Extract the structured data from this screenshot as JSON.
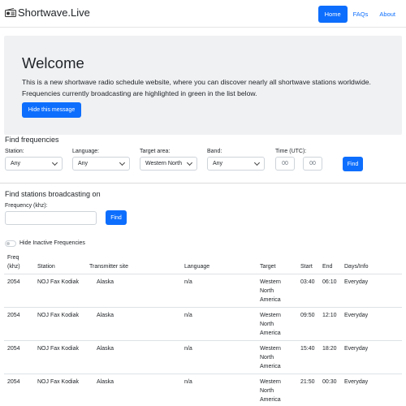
{
  "navbar": {
    "brand": "Shortwave.Live",
    "brand_icon": "radio-icon",
    "items": [
      {
        "label": "Home",
        "active": true
      },
      {
        "label": "FAQs",
        "active": false
      },
      {
        "label": "About",
        "active": false
      }
    ]
  },
  "welcome": {
    "title": "Welcome",
    "text": "This is a new shortwave radio schedule website, where you can discover nearly all shortwave stations worldwide. Frequencies currently broadcasting are highlighted in green in the list below.",
    "hide_button": "Hide this message"
  },
  "find_frequencies": {
    "title": "Find frequencies",
    "station_label": "Station:",
    "station_value": "Any",
    "language_label": "Language:",
    "language_value": "Any",
    "target_label": "Target area:",
    "target_value": "Western North",
    "band_label": "Band:",
    "band_value": "Any",
    "time_label": "Time (UTC):",
    "time_from_placeholder": "00",
    "time_to_placeholder": "00",
    "find_button": "Find"
  },
  "find_stations": {
    "title": "Find stations broadcasting on",
    "frequency_label": "Frequency (khz):",
    "frequency_value": "",
    "find_button": "Find"
  },
  "toggle": {
    "label": "Hide Inactive Frequencies",
    "checked": false
  },
  "table": {
    "headers": {
      "freq_line1": "Freq",
      "freq_line2": "(khz)",
      "station": "Station",
      "site": "Transmitter site",
      "language": "Language",
      "target": "Target",
      "start": "Start",
      "end": "End",
      "days": "Days/Info"
    },
    "rows": [
      {
        "freq": "2054",
        "station": "NOJ Fax Kodiak",
        "site": "Alaska",
        "language": "n/a",
        "target": [
          "Western",
          "North",
          "America"
        ],
        "start": "03:40",
        "end": "06:10",
        "days": "Everyday"
      },
      {
        "freq": "2054",
        "station": "NOJ Fax Kodiak",
        "site": "Alaska",
        "language": "n/a",
        "target": [
          "Western",
          "North",
          "America"
        ],
        "start": "09:50",
        "end": "12:10",
        "days": "Everyday"
      },
      {
        "freq": "2054",
        "station": "NOJ Fax Kodiak",
        "site": "Alaska",
        "language": "n/a",
        "target": [
          "Western",
          "North",
          "America"
        ],
        "start": "15:40",
        "end": "18:20",
        "days": "Everyday"
      },
      {
        "freq": "2054",
        "station": "NOJ Fax Kodiak",
        "site": "Alaska",
        "language": "n/a",
        "target": [
          "Western",
          "North",
          "America"
        ],
        "start": "21:50",
        "end": "00:30",
        "days": "Everyday"
      }
    ]
  },
  "colors": {
    "primary": "#0d6efd",
    "jumbotron_bg": "#f0f1f3"
  }
}
